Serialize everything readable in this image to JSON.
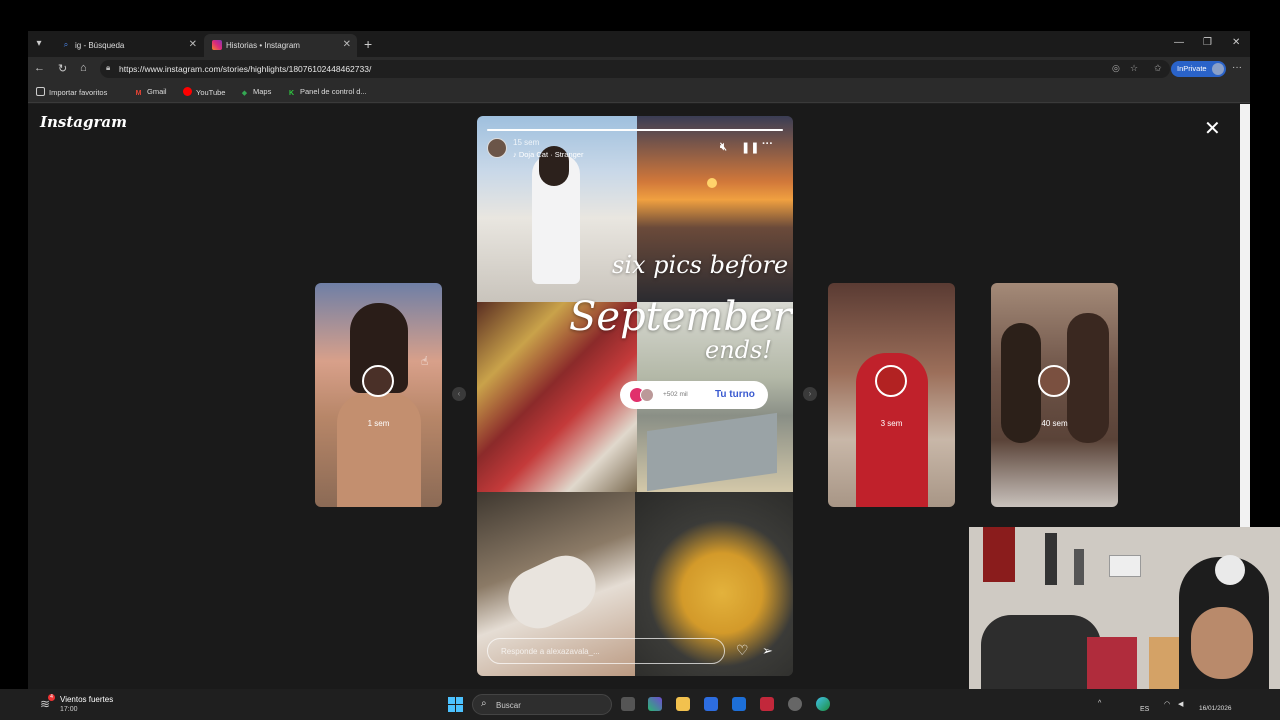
{
  "browser": {
    "tabs": [
      {
        "label": "ig - Búsqueda",
        "icon": "search-icon"
      },
      {
        "label": "Historias • Instagram",
        "icon": "instagram-icon",
        "active": true
      }
    ],
    "url": "https://www.instagram.com/stories/highlights/18076102448462733/",
    "inprivate_label": "InPrivate",
    "bookmarks": [
      {
        "label": "Importar favoritos",
        "icon": "import-icon"
      },
      {
        "label": "Gmail",
        "icon": "gmail-icon"
      },
      {
        "label": "YouTube",
        "icon": "youtube-icon"
      },
      {
        "label": "Maps",
        "icon": "maps-icon"
      },
      {
        "label": "Panel de control d...",
        "icon": "panel-icon"
      }
    ]
  },
  "instagram": {
    "logo": "Instagram",
    "side_stories": [
      {
        "time": "1 sem"
      },
      {
        "time": "3 sem"
      },
      {
        "time": "40 sem"
      }
    ],
    "story": {
      "time": "15 sem",
      "song": "Doja Cat · Stranger",
      "progress": 1.0,
      "headline_line1": "six pics before",
      "headline_line2": "September",
      "headline_line3": "ends!",
      "count": "+502 mil",
      "turn_label": "Tu turno",
      "reply_placeholder": "Responde a alexazavala_..."
    }
  },
  "taskbar": {
    "weather_title": "Vientos fuertes",
    "weather_time": "17:00",
    "search_label": "Buscar",
    "lang": "ES",
    "date": "16/01/2026"
  },
  "colors": {
    "accent": "#3b5bd0",
    "inprivate": "#2a63c9",
    "instagram_pink": "#e1306c"
  }
}
